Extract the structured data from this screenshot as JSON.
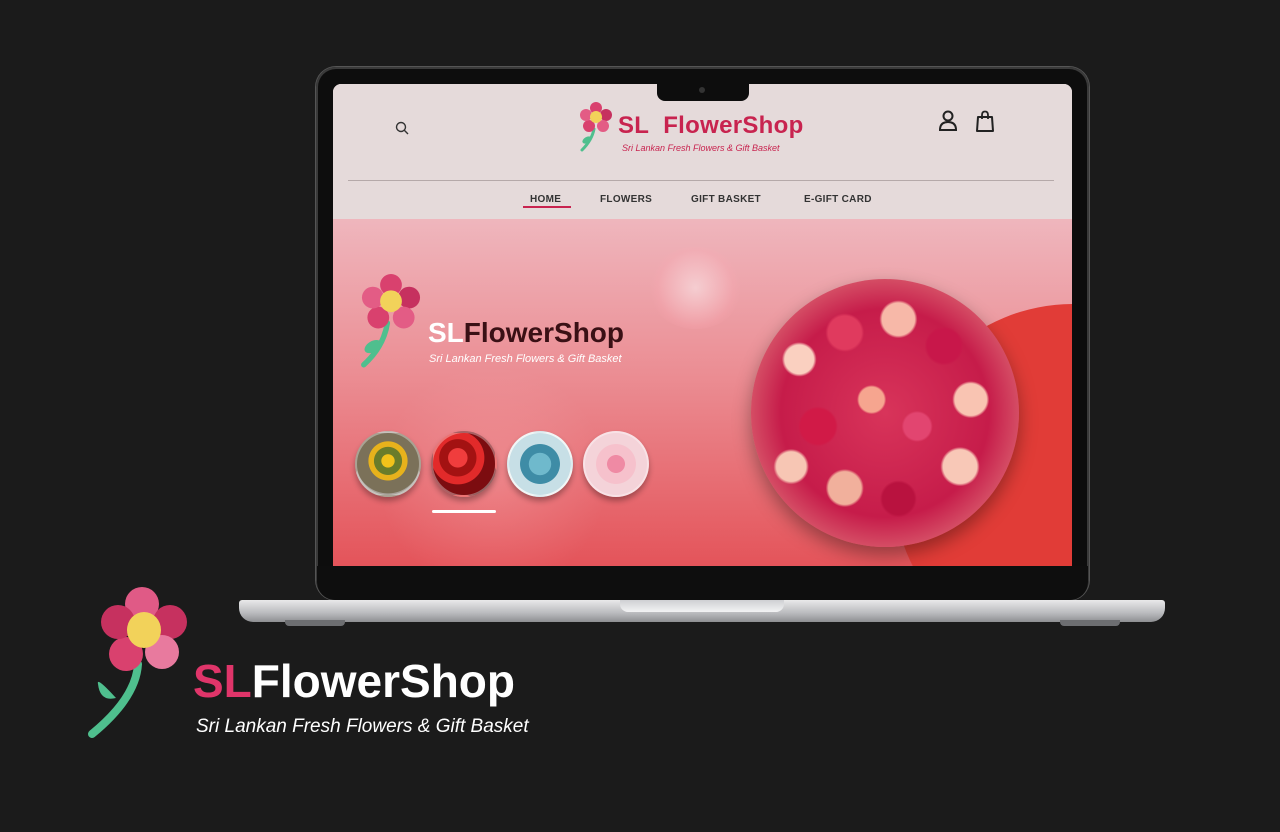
{
  "site": {
    "brand_sl": "SL",
    "brand_rest": "FlowerShop",
    "brand_tagline": "Sri Lankan Fresh Flowers & Gift Basket"
  },
  "nav": {
    "items": [
      {
        "label": "HOME"
      },
      {
        "label": "FLOWERS"
      },
      {
        "label": "GIFT BASKET"
      },
      {
        "label": "E-GIFT CARD"
      }
    ]
  },
  "hero": {
    "brand_sl": "SL",
    "brand_rest": "FlowerShop",
    "tagline": "Sri Lankan Fresh Flowers & Gift Basket"
  },
  "footer_brand": {
    "sl": "SL",
    "rest": "FlowerShop",
    "tagline": "Sri Lankan Fresh Flowers & Gift Basket"
  },
  "icons": {
    "search": "search-icon",
    "user": "user-icon",
    "bag": "shopping-bag-icon",
    "logo": "flower-logo-icon"
  },
  "colors": {
    "accent": "#c8234f",
    "background": "#1b1b1b",
    "hero_red": "#e13c37"
  }
}
